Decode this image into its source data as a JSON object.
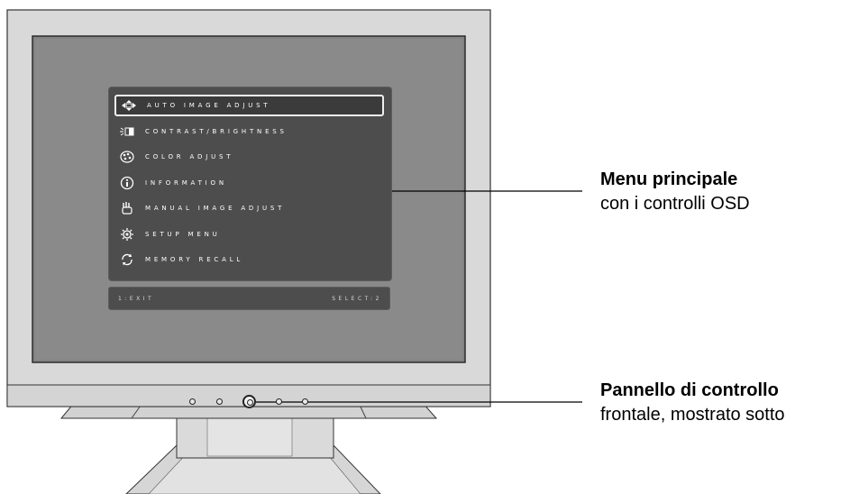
{
  "osd": {
    "items": [
      {
        "label": "AUTO IMAGE ADJUST",
        "icon": "auto-adjust-icon",
        "selected": true
      },
      {
        "label": "CONTRAST/BRIGHTNESS",
        "icon": "contrast-brightness-icon",
        "selected": false
      },
      {
        "label": "COLOR ADJUST",
        "icon": "color-palette-icon",
        "selected": false
      },
      {
        "label": "INFORMATION",
        "icon": "information-icon",
        "selected": false
      },
      {
        "label": "MANUAL IMAGE ADJUST",
        "icon": "manual-adjust-icon",
        "selected": false
      },
      {
        "label": "SETUP MENU",
        "icon": "setup-gear-icon",
        "selected": false
      },
      {
        "label": "MEMORY RECALL",
        "icon": "memory-recall-icon",
        "selected": false
      }
    ],
    "footer_left": "1:EXIT",
    "footer_right": "SELECT:2"
  },
  "callouts": {
    "main_menu_title": "Menu principale",
    "main_menu_sub": "con i controlli OSD",
    "control_panel_title": "Pannello di controllo",
    "control_panel_sub": "frontale, mostrato sotto"
  },
  "colors": {
    "bezel": "#d9d9d9",
    "screen": "#8a8a8a",
    "osd_bg": "#4d4d4d",
    "outline": "#333333"
  }
}
